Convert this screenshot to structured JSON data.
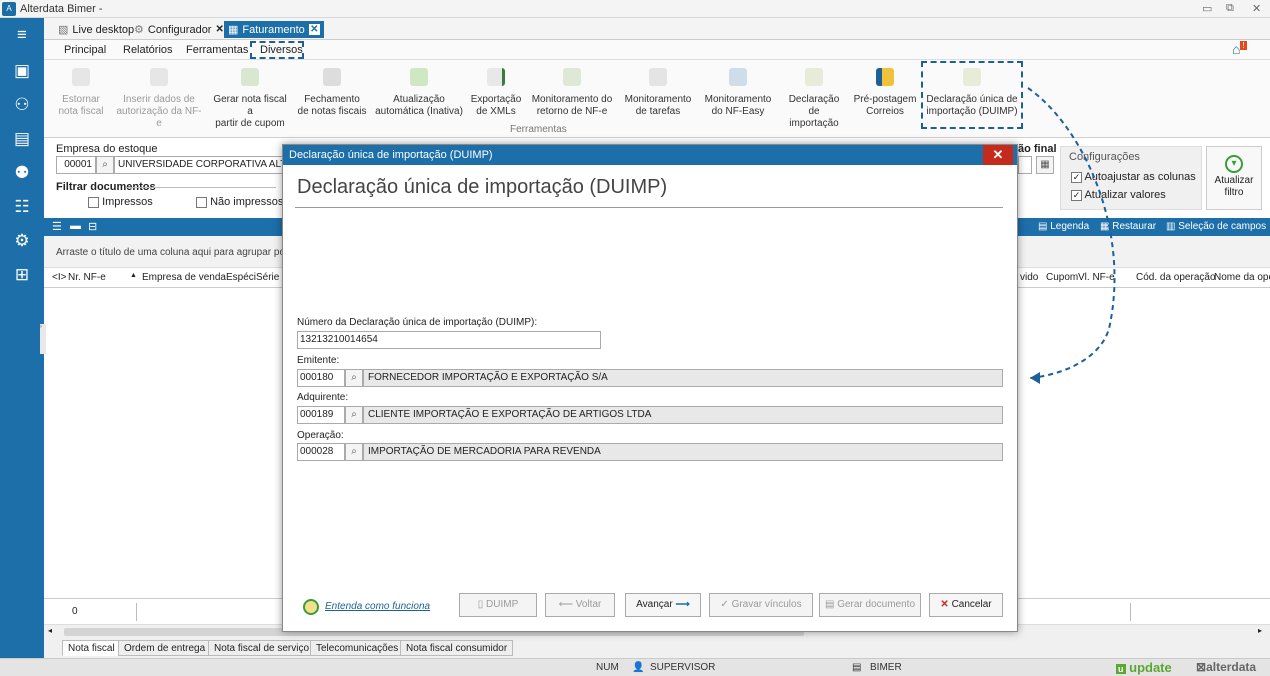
{
  "window": {
    "title": "Alterdata Bimer -"
  },
  "doc_tabs": [
    {
      "label": "Live desktop"
    },
    {
      "label": "Configurador"
    },
    {
      "label": "Faturamento"
    }
  ],
  "menu": [
    "Principal",
    "Relatórios",
    "Ferramentas",
    "Diversos"
  ],
  "ribbon": {
    "buttons": [
      {
        "l1": "Estornar",
        "l2": "nota fiscal"
      },
      {
        "l1": "Inserir dados de",
        "l2": "autorização da NF-e"
      },
      {
        "l1": "Gerar nota fiscal a",
        "l2": "partir de cupom"
      },
      {
        "l1": "Fechamento",
        "l2": "de notas fiscais"
      },
      {
        "l1": "Atualização",
        "l2": "automática (Inativa)"
      },
      {
        "l1": "Exportação",
        "l2": "de XMLs"
      },
      {
        "l1": "Monitoramento do",
        "l2": "retorno de NF-e"
      },
      {
        "l1": "Monitoramento",
        "l2": "de tarefas"
      },
      {
        "l1": "Monitoramento",
        "l2": "do NF-Easy"
      },
      {
        "l1": "Declaração de",
        "l2": "importação"
      },
      {
        "l1": "Pré-postagem",
        "l2": "Correios"
      },
      {
        "l1": "Declaração única de",
        "l2": "importação (DUIMP)"
      }
    ],
    "group_label": "Ferramentas"
  },
  "filter": {
    "empresa_label": "Empresa do estoque",
    "empresa_code": "00001",
    "empresa_name": "UNIVERSIDADE CORPORATIVA ALTERDA",
    "filtrar_label": "Filtrar documentos",
    "impressos": "Impressos",
    "nao_impressos": "Não impressos",
    "data_final_partial": "ão final",
    "config_label": "Configurações",
    "autoajustar": "Autoajustar as colunas",
    "atualizar_valores": "Atualizar valores",
    "atualizar_filtro_l1": "Atualizar",
    "atualizar_filtro_l2": "filtro"
  },
  "gridtool": {
    "legenda": "Legenda",
    "restaurar": "Restaurar",
    "selecao": "Seleção de campos"
  },
  "grid": {
    "group_hint": "Arraste o título de uma coluna aqui para agrupar por e",
    "left_cols": [
      "<I>",
      "Nr. NF-e",
      "Empresa de venda",
      "Espéci",
      "Série"
    ],
    "right_cols": [
      "vido",
      "Cupom",
      "Vl. NF-e",
      "Cód. da operação",
      "Nome da ope"
    ],
    "footer_count": "0"
  },
  "bottom_tabs": [
    "Nota fiscal",
    "Ordem de entrega",
    "Nota fiscal de serviço",
    "Telecomunicações",
    "Nota fiscal consumidor"
  ],
  "status": {
    "num": "NUM",
    "user": "SUPERVISOR",
    "db": "BIMER",
    "brand1": "update",
    "brand2": "alterdata"
  },
  "dialog": {
    "title": "Declaração única de importação (DUIMP)",
    "heading": "Declaração única de importação (DUIMP)",
    "numero_label": "Número da Declaração única de importação (DUIMP):",
    "numero_value": "13213210014654",
    "emitente_label": "Emitente:",
    "emitente_code": "000180",
    "emitente_name": "FORNECEDOR IMPORTAÇÃO E EXPORTAÇÃO S/A",
    "adquirente_label": "Adquirente:",
    "adquirente_code": "000189",
    "adquirente_name": "CLIENTE IMPORTAÇÃO E EXPORTAÇÃO DE ARTIGOS LTDA",
    "operacao_label": "Operação:",
    "operacao_code": "000028",
    "operacao_name": "IMPORTAÇÃO DE MERCADORIA PARA REVENDA",
    "help_link": "Entenda como funciona",
    "buttons": {
      "duimp": "DUIMP",
      "voltar": "Voltar",
      "avancar": "Avançar",
      "gravar": "Gravar vínculos",
      "gerar": "Gerar documento",
      "cancelar": "Cancelar"
    }
  },
  "colors": {
    "accent": "#1d6faa",
    "close": "#c42b1c",
    "dash": "#1d5f99"
  }
}
